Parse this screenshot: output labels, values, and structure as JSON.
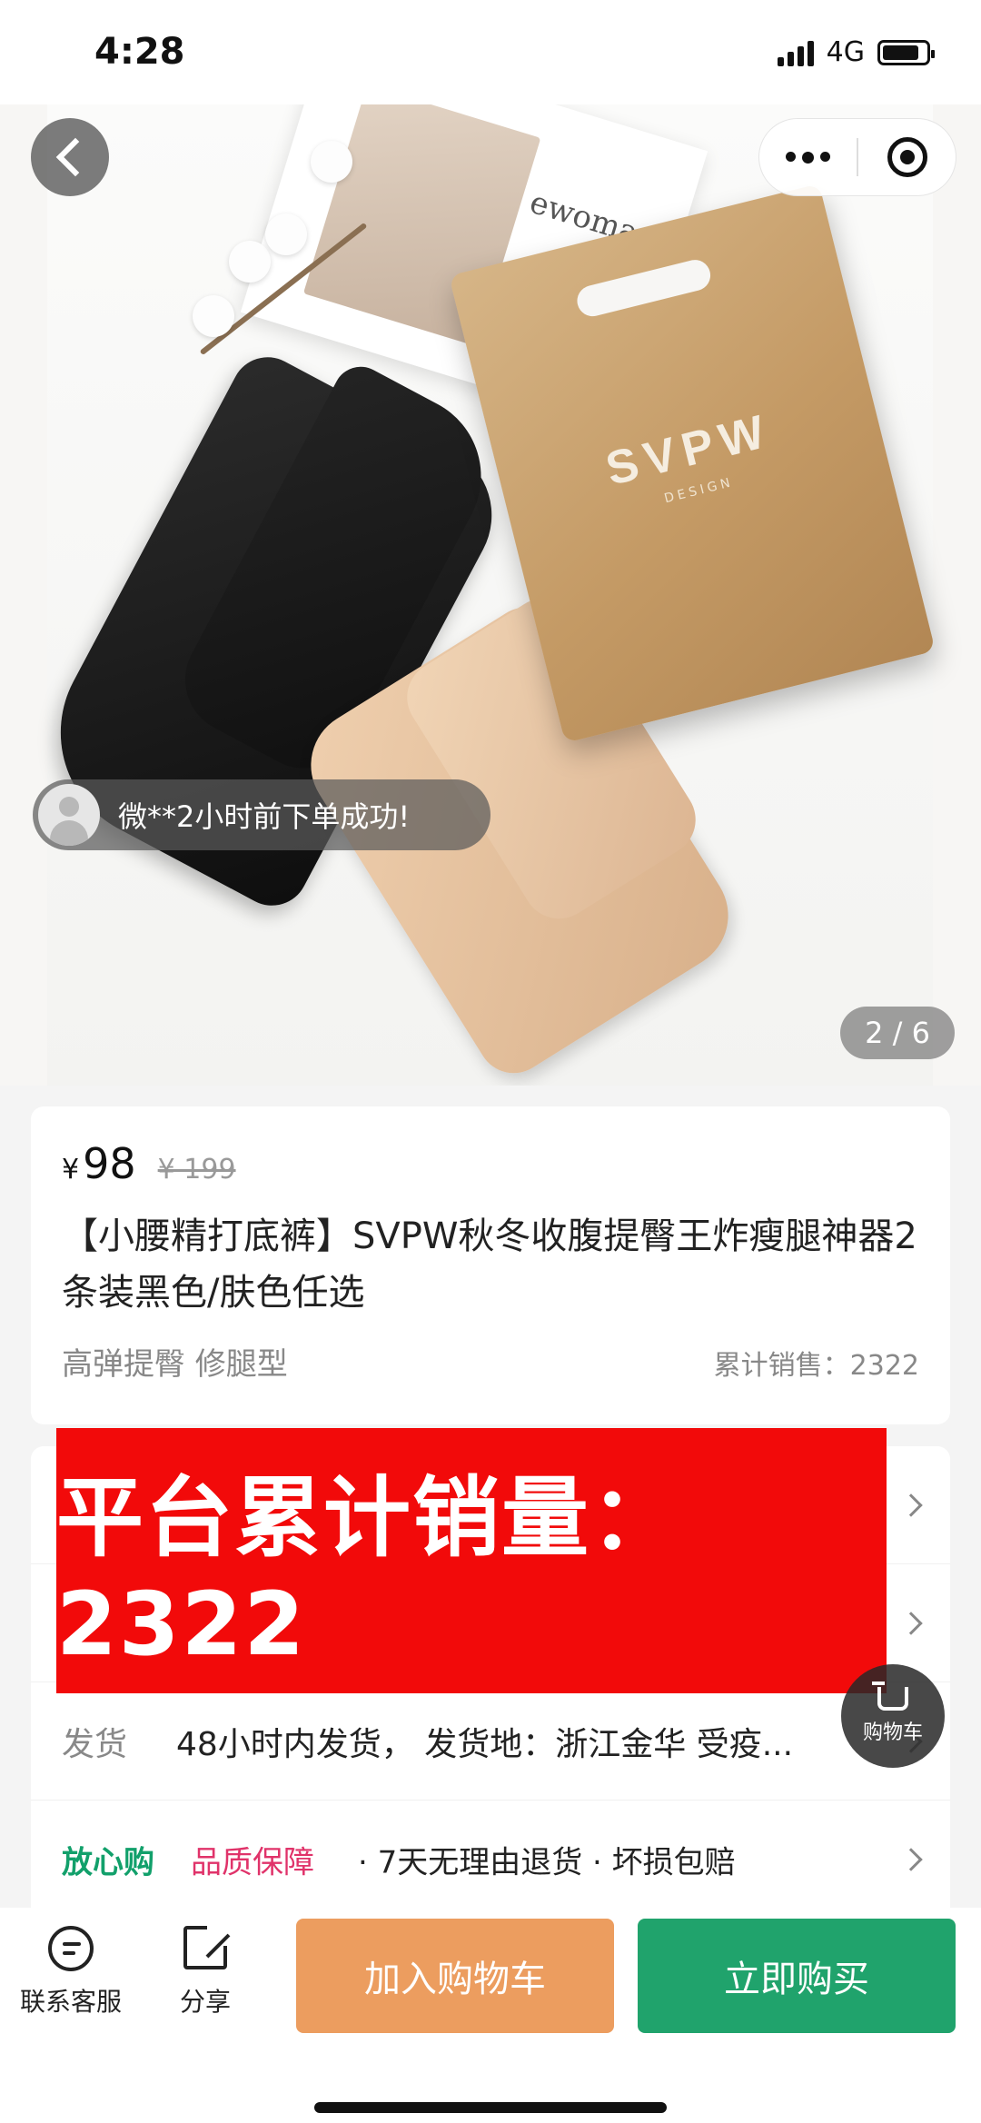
{
  "status_bar": {
    "time": "4:28",
    "network": "4G",
    "battery_level": 0.85
  },
  "gallery": {
    "page_indicator": "2 / 6",
    "bag_brand": "SVPW",
    "bag_brand_sub": "DESIGN",
    "card_text": "ewoman",
    "toast": "微**2小时前下单成功!"
  },
  "nav": {
    "back_icon": "chevron-left-icon",
    "more_icon": "more-dots-icon",
    "close_icon": "target-close-icon"
  },
  "product": {
    "currency": "¥",
    "price": "98",
    "original_price": "¥ 199",
    "title": "【小腰精打底裤】SVPW秋冬收腹提臀王炸瘦腿神器2条装黑色/肤色任选",
    "tags": "高弹提臀 修腿型",
    "sales": "累计销售：2322"
  },
  "banner": {
    "text": "平台累计销量：2322",
    "color": "#f20a0a"
  },
  "service": {
    "shipping_label": "发货",
    "shipping_value": "48小时内发货， 发货地：浙江金华 受疫...",
    "assure_label": "放心购",
    "quality_label": "品质保障",
    "policy": "· 7天无理由退货 · 坏损包赔"
  },
  "float_cart": {
    "label": "购物车"
  },
  "bottom_bar": {
    "service_label": "联系客服",
    "share_label": "分享",
    "add_cart_label": "加入购物车",
    "buy_now_label": "立即购买",
    "add_cart_color": "#ec9d5f",
    "buy_now_color": "#20a36c"
  }
}
